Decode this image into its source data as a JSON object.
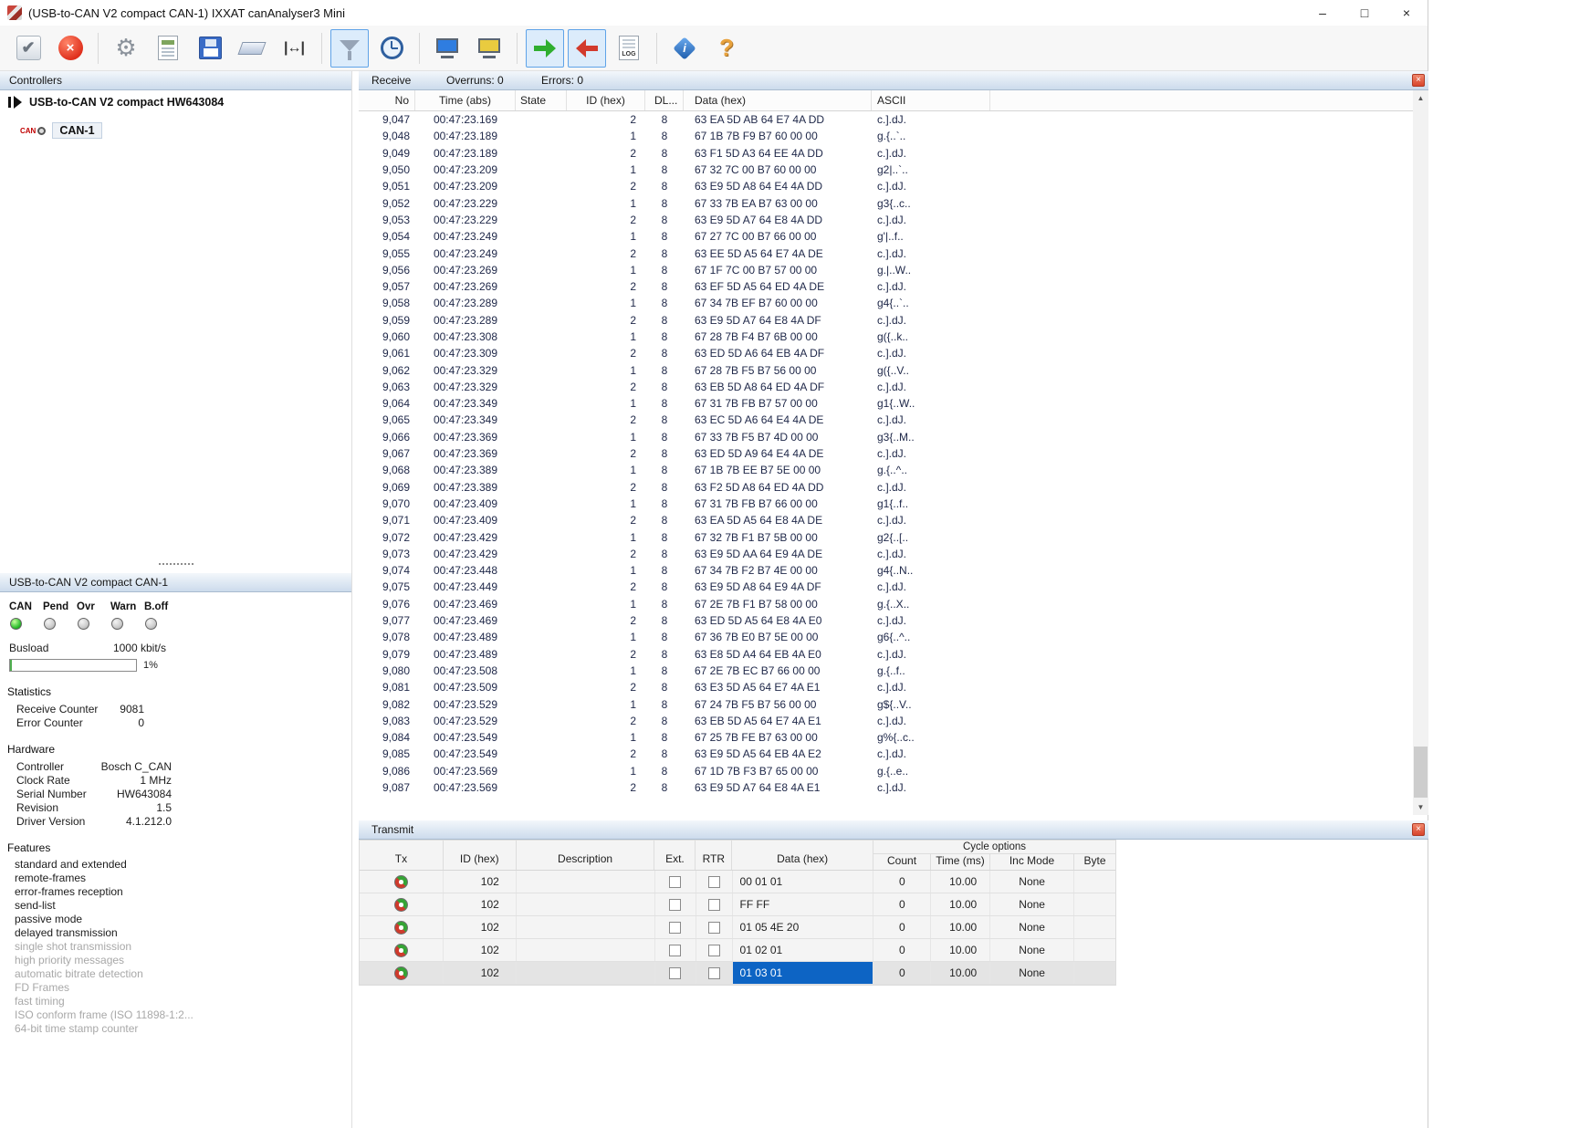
{
  "titlebar": {
    "title": "(USB-to-CAN V2 compact  CAN-1) IXXAT canAnalyser3 Mini",
    "minimize_glyph": "–",
    "maximize_glyph": "□",
    "close_glyph": "×"
  },
  "toolbar": {
    "buttons": [
      {
        "name": "apply-button",
        "icon": "check-icon",
        "glyph": "✔",
        "selected": false
      },
      {
        "name": "cancel-button",
        "icon": "cancel-icon",
        "glyph": "×",
        "selected": false
      },
      {
        "sep": true
      },
      {
        "name": "settings-button",
        "icon": "gear-icon",
        "glyph": "⚙",
        "selected": false
      },
      {
        "name": "report-button",
        "icon": "report-icon",
        "glyph": "",
        "selected": false
      },
      {
        "name": "save-button",
        "icon": "save-icon",
        "glyph": "",
        "selected": false
      },
      {
        "name": "eraser-button",
        "icon": "eraser-icon",
        "glyph": "",
        "selected": false
      },
      {
        "name": "measure-span-button",
        "icon": "span-icon",
        "glyph": "|↔|",
        "selected": false
      },
      {
        "sep": true
      },
      {
        "name": "filter-button",
        "icon": "funnel-icon",
        "glyph": "",
        "selected": true
      },
      {
        "name": "time-mode-button",
        "icon": "clock-icon",
        "glyph": "",
        "selected": false
      },
      {
        "sep": true
      },
      {
        "name": "bus-monitor-button",
        "icon": "monitor-blue-icon",
        "glyph": "",
        "selected": false
      },
      {
        "name": "bus-bridge-button",
        "icon": "monitor-yellow-icon",
        "glyph": "",
        "selected": false
      },
      {
        "sep": true
      },
      {
        "name": "start-button",
        "icon": "arrow-right-green-icon",
        "glyph": "",
        "selected": true
      },
      {
        "name": "stop-button",
        "icon": "arrow-left-red-icon",
        "glyph": "",
        "selected": true
      },
      {
        "name": "log-button",
        "icon": "log-icon",
        "glyph": "LOG",
        "selected": false
      },
      {
        "sep": true
      },
      {
        "name": "info-button",
        "icon": "info-icon",
        "glyph": "i",
        "selected": false
      },
      {
        "name": "help-button",
        "icon": "help-icon",
        "glyph": "?",
        "selected": false
      }
    ]
  },
  "controllers": {
    "title": "Controllers",
    "device": "USB-to-CAN V2 compact  HW643084",
    "channel": "CAN-1",
    "channel_icon_text": "CAN"
  },
  "status": {
    "title": "USB-to-CAN V2 compact  CAN-1",
    "led_labels": [
      "CAN",
      "Pend",
      "Ovr",
      "Warn",
      "B.off"
    ],
    "led_on": [
      true,
      false,
      false,
      false,
      false
    ],
    "busload_label": "Busload",
    "busload_rate": "1000 kbit/s",
    "busload_value": "1%",
    "statistics": {
      "title": "Statistics",
      "rows": [
        [
          "Receive Counter",
          "9081"
        ],
        [
          "Error Counter",
          "0"
        ]
      ]
    },
    "hardware": {
      "title": "Hardware",
      "rows": [
        [
          "Controller",
          "Bosch C_CAN"
        ],
        [
          "Clock Rate",
          "1 MHz"
        ],
        [
          "Serial Number",
          "HW643084"
        ],
        [
          "Revision",
          "1.5"
        ],
        [
          "Driver Version",
          "4.1.212.0"
        ]
      ]
    },
    "features": {
      "title": "Features",
      "supported": [
        "standard and extended",
        "remote-frames",
        "error-frames reception",
        "send-list",
        "passive mode",
        "delayed transmission"
      ],
      "unsupported": [
        "single shot transmission",
        "high priority messages",
        "automatic bitrate detection",
        "FD Frames",
        "fast timing",
        "ISO conform frame (ISO 11898-1:2...",
        "64-bit time stamp counter"
      ]
    }
  },
  "receive": {
    "title": "Receive",
    "overruns": "Overruns: 0",
    "errors": "Errors: 0",
    "close_glyph": "×",
    "scroll_up_glyph": "▲",
    "scroll_down_glyph": "▼",
    "columns": {
      "no": "No",
      "time": "Time (abs)",
      "state": "State",
      "id": "ID (hex)",
      "dlc": "DL...",
      "data": "Data (hex)",
      "ascii": "ASCII"
    },
    "rows": [
      [
        "9,047",
        "00:47:23.169",
        "",
        "2",
        "8",
        "63 EA 5D AB 64 E7 4A DD",
        "c.].dJ."
      ],
      [
        "9,048",
        "00:47:23.189",
        "",
        "1",
        "8",
        "67 1B 7B F9 B7 60 00 00",
        "g.{..`.."
      ],
      [
        "9,049",
        "00:47:23.189",
        "",
        "2",
        "8",
        "63 F1 5D A3 64 EE 4A DD",
        "c.].dJ."
      ],
      [
        "9,050",
        "00:47:23.209",
        "",
        "1",
        "8",
        "67 32 7C 00 B7 60 00 00",
        "g2|..`.."
      ],
      [
        "9,051",
        "00:47:23.209",
        "",
        "2",
        "8",
        "63 E9 5D A8 64 E4 4A DD",
        "c.].dJ."
      ],
      [
        "9,052",
        "00:47:23.229",
        "",
        "1",
        "8",
        "67 33 7B EA B7 63 00 00",
        "g3{..c.."
      ],
      [
        "9,053",
        "00:47:23.229",
        "",
        "2",
        "8",
        "63 E9 5D A7 64 E8 4A DD",
        "c.].dJ."
      ],
      [
        "9,054",
        "00:47:23.249",
        "",
        "1",
        "8",
        "67 27 7C 00 B7 66 00 00",
        "g'|..f.."
      ],
      [
        "9,055",
        "00:47:23.249",
        "",
        "2",
        "8",
        "63 EE 5D A5 64 E7 4A DE",
        "c.].dJ."
      ],
      [
        "9,056",
        "00:47:23.269",
        "",
        "1",
        "8",
        "67 1F 7C 00 B7 57 00 00",
        "g.|..W.."
      ],
      [
        "9,057",
        "00:47:23.269",
        "",
        "2",
        "8",
        "63 EF 5D A5 64 ED 4A DE",
        "c.].dJ."
      ],
      [
        "9,058",
        "00:47:23.289",
        "",
        "1",
        "8",
        "67 34 7B EF B7 60 00 00",
        "g4{..`.."
      ],
      [
        "9,059",
        "00:47:23.289",
        "",
        "2",
        "8",
        "63 E9 5D A7 64 E8 4A DF",
        "c.].dJ."
      ],
      [
        "9,060",
        "00:47:23.308",
        "",
        "1",
        "8",
        "67 28 7B F4 B7 6B 00 00",
        "g({..k.."
      ],
      [
        "9,061",
        "00:47:23.309",
        "",
        "2",
        "8",
        "63 ED 5D A6 64 EB 4A DF",
        "c.].dJ."
      ],
      [
        "9,062",
        "00:47:23.329",
        "",
        "1",
        "8",
        "67 28 7B F5 B7 56 00 00",
        "g({..V.."
      ],
      [
        "9,063",
        "00:47:23.329",
        "",
        "2",
        "8",
        "63 EB 5D A8 64 ED 4A DF",
        "c.].dJ."
      ],
      [
        "9,064",
        "00:47:23.349",
        "",
        "1",
        "8",
        "67 31 7B FB B7 57 00 00",
        "g1{..W.."
      ],
      [
        "9,065",
        "00:47:23.349",
        "",
        "2",
        "8",
        "63 EC 5D A6 64 E4 4A DE",
        "c.].dJ."
      ],
      [
        "9,066",
        "00:47:23.369",
        "",
        "1",
        "8",
        "67 33 7B F5 B7 4D 00 00",
        "g3{..M.."
      ],
      [
        "9,067",
        "00:47:23.369",
        "",
        "2",
        "8",
        "63 ED 5D A9 64 E4 4A DE",
        "c.].dJ."
      ],
      [
        "9,068",
        "00:47:23.389",
        "",
        "1",
        "8",
        "67 1B 7B EE B7 5E 00 00",
        "g.{..^.."
      ],
      [
        "9,069",
        "00:47:23.389",
        "",
        "2",
        "8",
        "63 F2 5D A8 64 ED 4A DD",
        "c.].dJ."
      ],
      [
        "9,070",
        "00:47:23.409",
        "",
        "1",
        "8",
        "67 31 7B FB B7 66 00 00",
        "g1{..f.."
      ],
      [
        "9,071",
        "00:47:23.409",
        "",
        "2",
        "8",
        "63 EA 5D A5 64 E8 4A DE",
        "c.].dJ."
      ],
      [
        "9,072",
        "00:47:23.429",
        "",
        "1",
        "8",
        "67 32 7B F1 B7 5B 00 00",
        "g2{..[.."
      ],
      [
        "9,073",
        "00:47:23.429",
        "",
        "2",
        "8",
        "63 E9 5D AA 64 E9 4A DE",
        "c.].dJ."
      ],
      [
        "9,074",
        "00:47:23.448",
        "",
        "1",
        "8",
        "67 34 7B F2 B7 4E 00 00",
        "g4{..N.."
      ],
      [
        "9,075",
        "00:47:23.449",
        "",
        "2",
        "8",
        "63 E9 5D A8 64 E9 4A DF",
        "c.].dJ."
      ],
      [
        "9,076",
        "00:47:23.469",
        "",
        "1",
        "8",
        "67 2E 7B F1 B7 58 00 00",
        "g.{..X.."
      ],
      [
        "9,077",
        "00:47:23.469",
        "",
        "2",
        "8",
        "63 ED 5D A5 64 E8 4A E0",
        "c.].dJ."
      ],
      [
        "9,078",
        "00:47:23.489",
        "",
        "1",
        "8",
        "67 36 7B E0 B7 5E 00 00",
        "g6{..^.."
      ],
      [
        "9,079",
        "00:47:23.489",
        "",
        "2",
        "8",
        "63 E8 5D A4 64 EB 4A E0",
        "c.].dJ."
      ],
      [
        "9,080",
        "00:47:23.508",
        "",
        "1",
        "8",
        "67 2E 7B EC B7 66 00 00",
        "g.{..f.."
      ],
      [
        "9,081",
        "00:47:23.509",
        "",
        "2",
        "8",
        "63 E3 5D A5 64 E7 4A E1",
        "c.].dJ."
      ],
      [
        "9,082",
        "00:47:23.529",
        "",
        "1",
        "8",
        "67 24 7B F5 B7 56 00 00",
        "g${..V.."
      ],
      [
        "9,083",
        "00:47:23.529",
        "",
        "2",
        "8",
        "63 EB 5D A5 64 E7 4A E1",
        "c.].dJ."
      ],
      [
        "9,084",
        "00:47:23.549",
        "",
        "1",
        "8",
        "67 25 7B FE B7 63 00 00",
        "g%{..c.."
      ],
      [
        "9,085",
        "00:47:23.549",
        "",
        "2",
        "8",
        "63 E9 5D A5 64 EB 4A E2",
        "c.].dJ."
      ],
      [
        "9,086",
        "00:47:23.569",
        "",
        "1",
        "8",
        "67 1D 7B F3 B7 65 00 00",
        "g.{..e.."
      ],
      [
        "9,087",
        "00:47:23.569",
        "",
        "2",
        "8",
        "63 E9 5D A7 64 E8 4A E1",
        "c.].dJ."
      ]
    ]
  },
  "transmit": {
    "title": "Transmit",
    "close_glyph": "×",
    "cycle_options_label": "Cycle options",
    "columns": {
      "tx": "Tx",
      "id": "ID (hex)",
      "desc": "Description",
      "ext": "Ext.",
      "rtr": "RTR",
      "data": "Data (hex)",
      "count": "Count",
      "time": "Time (ms)",
      "inc": "Inc Mode",
      "byte": "Byte"
    },
    "rows": [
      {
        "id": "102",
        "desc": "",
        "ext": false,
        "rtr": false,
        "data": "00 01 01",
        "count": "0",
        "time": "10.00",
        "inc": "None",
        "byte": "",
        "selected": false
      },
      {
        "id": "102",
        "desc": "",
        "ext": false,
        "rtr": false,
        "data": "FF FF",
        "count": "0",
        "time": "10.00",
        "inc": "None",
        "byte": "",
        "selected": false
      },
      {
        "id": "102",
        "desc": "",
        "ext": false,
        "rtr": false,
        "data": "01 05 4E 20",
        "count": "0",
        "time": "10.00",
        "inc": "None",
        "byte": "",
        "selected": false
      },
      {
        "id": "102",
        "desc": "",
        "ext": false,
        "rtr": false,
        "data": "01 02 01",
        "count": "0",
        "time": "10.00",
        "inc": "None",
        "byte": "",
        "selected": false
      },
      {
        "id": "102",
        "desc": "",
        "ext": false,
        "rtr": false,
        "data": "01 03 01",
        "count": "0",
        "time": "10.00",
        "inc": "None",
        "byte": "",
        "selected": true
      }
    ]
  }
}
